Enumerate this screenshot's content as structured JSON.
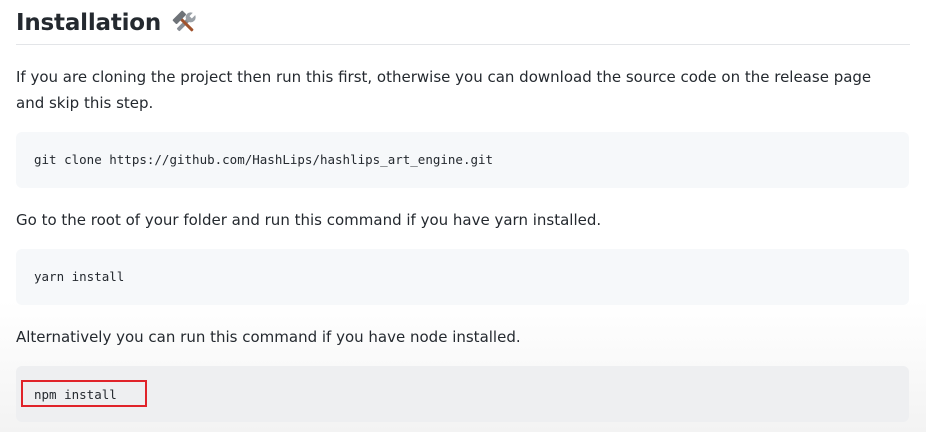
{
  "heading": {
    "title": "Installation",
    "icon": "tools-icon"
  },
  "paragraphs": [
    "If you are cloning the project then run this first, otherwise you can download the source code on the release page",
    "and skip this step.",
    "Go to the root of your folder and run this command if you have yarn installed.",
    "Alternatively you can run this command if you have node installed."
  ],
  "code_blocks": [
    "git clone https://github.com/HashLips/hashlips_art_engine.git",
    "yarn install",
    "npm install"
  ],
  "colors": {
    "text": "#24292f",
    "code_background": "#f6f8fa",
    "highlight": "#e0232a"
  }
}
